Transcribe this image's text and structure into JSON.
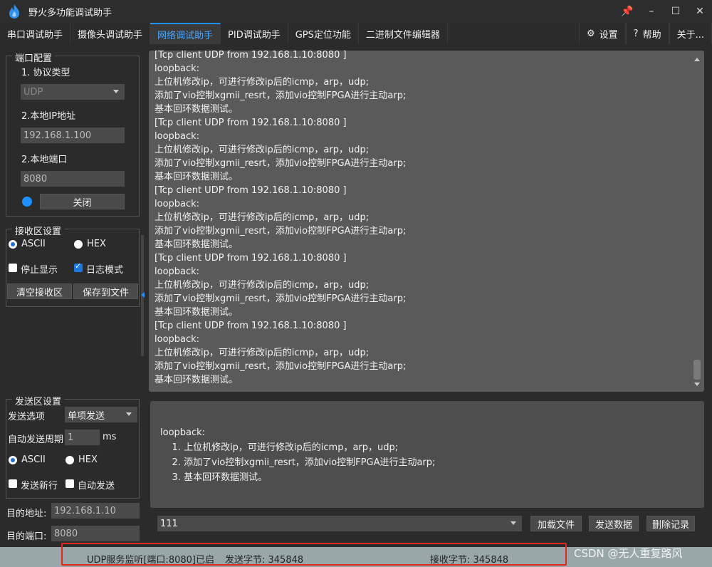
{
  "window": {
    "title": "野火多功能调试助手",
    "controls": [
      "📌",
      "–",
      "☐",
      "✕"
    ]
  },
  "tabs": [
    {
      "label": "串口调试助手"
    },
    {
      "label": "摄像头调试助手"
    },
    {
      "label": "网络调试助手"
    },
    {
      "label": "PID调试助手"
    },
    {
      "label": "GPS定位功能"
    },
    {
      "label": "二进制文件编辑器"
    }
  ],
  "tabs_right": [
    {
      "icon": "⚙",
      "label": "设置"
    },
    {
      "icon": "?",
      "label": "帮助"
    },
    {
      "label": "关于..."
    }
  ],
  "port_config": {
    "title": "端口配置",
    "protocol_label": "1. 协议类型",
    "protocol_value": "UDP",
    "ip_label": "2.本地IP地址",
    "ip_value": "192.168.1.100",
    "port_label": "2.本地端口",
    "port_value": "8080",
    "close_button": "关闭"
  },
  "recv_config": {
    "title": "接收区设置",
    "ascii": "ASCII",
    "hex": "HEX",
    "stop_display": "停止显示",
    "log_mode": "日志模式",
    "clear_button": "清空接收区",
    "save_button": "保存到文件"
  },
  "send_config": {
    "title": "发送区设置",
    "option_label": "发送选项",
    "option_value": "单项发送",
    "period_label": "自动发送周期",
    "period_value": "1",
    "period_unit": "ms",
    "ascii": "ASCII",
    "hex": "HEX",
    "newline": "发送新行",
    "auto_send": "自动发送",
    "dest_addr_label": "目的地址:",
    "dest_addr_value": "192.168.1.10",
    "dest_port_label": "目的端口:",
    "dest_port_value": "8080"
  },
  "receive": {
    "lines": [
      "[Tcp client  UDP from 192.168.1.10:8080 ]",
      "loopback:",
      "上位机修改ip，可进行修改ip后的icmp，arp，udp;",
      "添加了vio控制xgmii_resrt，添加vio控制FPGA进行主动arp;",
      "基本回环数据测试。",
      "[Tcp client  UDP from 192.168.1.10:8080 ]",
      "loopback:",
      "上位机修改ip，可进行修改ip后的icmp，arp，udp;",
      "添加了vio控制xgmii_resrt，添加vio控制FPGA进行主动arp;",
      "基本回环数据测试。",
      "[Tcp client  UDP from 192.168.1.10:8080 ]",
      "loopback:",
      "上位机修改ip，可进行修改ip后的icmp，arp，udp;",
      "添加了vio控制xgmii_resrt，添加vio控制FPGA进行主动arp;",
      "基本回环数据测试。",
      "[Tcp client  UDP from 192.168.1.10:8080 ]",
      "loopback:",
      "上位机修改ip，可进行修改ip后的icmp，arp，udp;",
      "添加了vio控制xgmii_resrt，添加vio控制FPGA进行主动arp;",
      "基本回环数据测试。",
      "[Tcp client  UDP from 192.168.1.10:8080 ]",
      "loopback:",
      "上位机修改ip，可进行修改ip后的icmp，arp，udp;",
      "添加了vio控制xgmii_resrt，添加vio控制FPGA进行主动arp;",
      "基本回环数据测试。"
    ]
  },
  "send": {
    "lines": [
      "loopback:",
      "",
      "    1. 上位机修改ip，可进行修改ip后的icmp，arp，udp;",
      "    2. 添加了vio控制xgmii_resrt，添加vio控制FPGA进行主动arp;",
      "    3. 基本回环数据测试。"
    ],
    "history_value": "111",
    "load_file_button": "加载文件",
    "send_button": "发送数据",
    "delete_button": "删除记录"
  },
  "status": {
    "listen": "UDP服务监听[端口:8080]已启动",
    "sent": "发送字节: 345848",
    "received": "接收字节: 345848"
  },
  "watermark": "CSDN @无人重复路风",
  "colors": {
    "accent": "#1e90ff",
    "highlight_frame": "#e0271e"
  }
}
